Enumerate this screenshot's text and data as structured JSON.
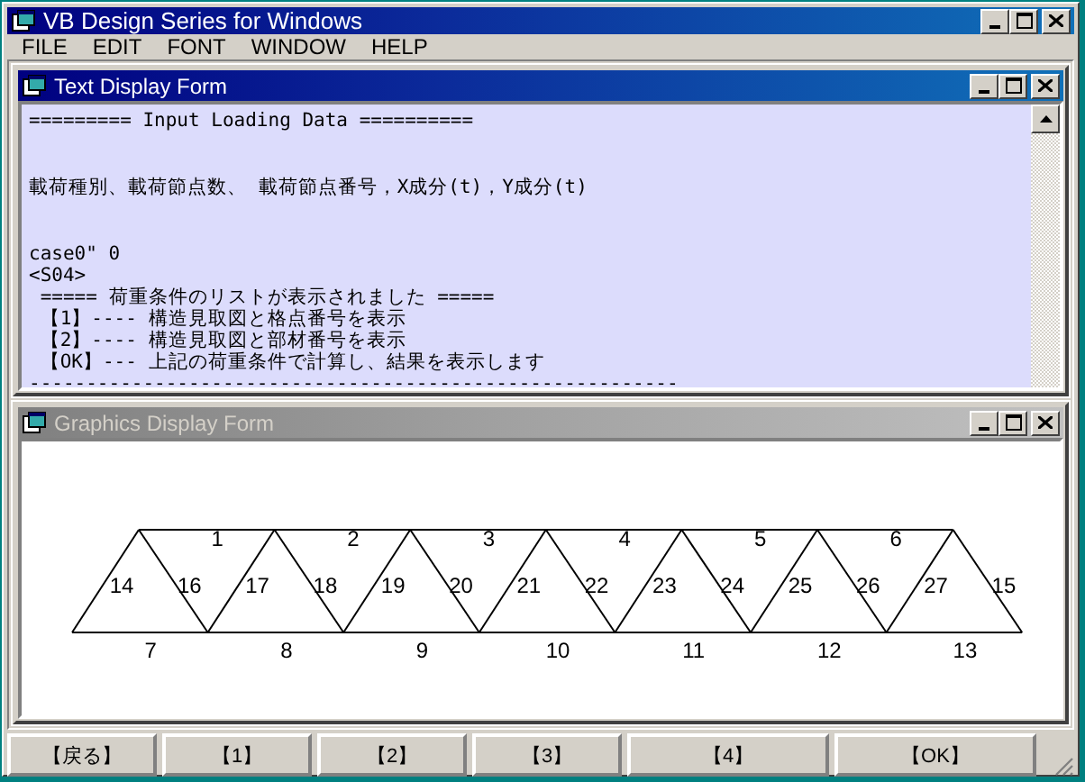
{
  "window": {
    "title": "VB Design Series for Windows",
    "active": true
  },
  "menu": [
    "FILE",
    "EDIT",
    "FONT",
    "WINDOW",
    "HELP"
  ],
  "child_windows": [
    {
      "kind": "text",
      "title": "Text Display Form",
      "active": true,
      "blocks": [
        [
          "========= Input Loading Data =========="
        ],
        [
          "載荷種別、載荷節点数、 載荷節点番号，X成分(t)，Y成分(t)"
        ],
        [
          "case0\" 0",
          "<S04>",
          " ===== 荷重条件のリストが表示されました =====",
          " 【1】---- 構造見取図と格点番号を表示",
          " 【2】---- 構造見取図と部材番号を表示",
          " 【OK】--- 上記の荷重条件で計算し、結果を表示します",
          "---------------------------------------------------------"
        ]
      ]
    },
    {
      "kind": "graphics",
      "title": "Graphics Display Form",
      "active": false,
      "truss": {
        "top_labels": [
          "1",
          "2",
          "3",
          "4",
          "5",
          "6"
        ],
        "bottom_labels": [
          "7",
          "8",
          "9",
          "10",
          "11",
          "12",
          "13"
        ],
        "diagonal_labels": [
          "14",
          "16",
          "17",
          "18",
          "19",
          "20",
          "21",
          "22",
          "23",
          "24",
          "25",
          "26",
          "27",
          "15"
        ]
      }
    }
  ],
  "buttons": [
    "【戻る】",
    "【1】",
    "【2】",
    "【3】",
    "【4】",
    "【OK】"
  ]
}
